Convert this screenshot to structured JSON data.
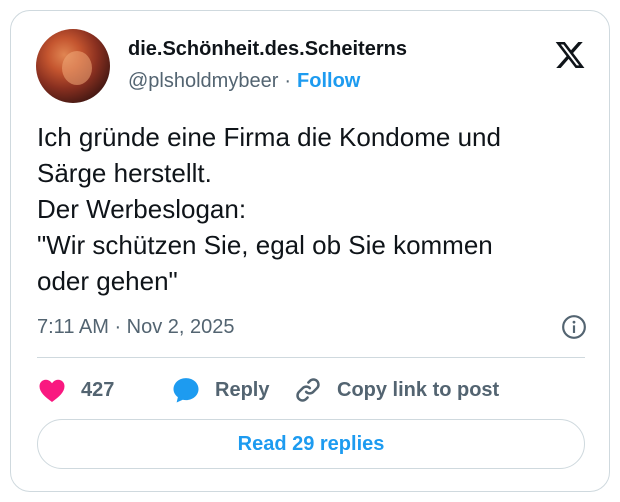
{
  "author": {
    "display_name": "die.Schönheit.des.Scheiterns",
    "handle": "@plsholdmybeer",
    "separator": "·",
    "follow_label": "Follow"
  },
  "tweet": {
    "lines": [
      "Ich gründe eine Firma die Kondome und",
      "Särge herstellt.",
      "Der Werbeslogan:",
      "\"Wir schützen Sie, egal ob Sie kommen",
      "oder gehen\""
    ],
    "timestamp": "7:11 AM · Nov 2, 2025"
  },
  "actions": {
    "like_count": "427",
    "reply_label": "Reply",
    "copy_label": "Copy link to post"
  },
  "read_replies_label": "Read 29 replies",
  "colors": {
    "accent": "#1d9bf0",
    "like": "#f91880",
    "muted": "#536471",
    "border": "#cfd9de"
  },
  "icons": [
    "x-logo-icon",
    "info-icon",
    "heart-icon",
    "reply-bubble-icon",
    "link-icon"
  ]
}
